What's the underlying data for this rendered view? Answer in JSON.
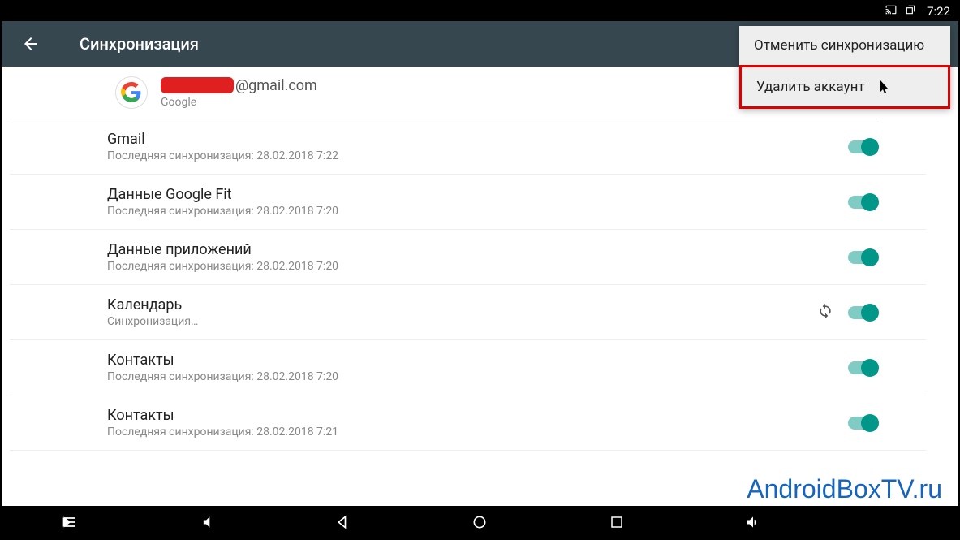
{
  "status": {
    "time": "7:22"
  },
  "appbar": {
    "title": "Синхронизация"
  },
  "menu": {
    "cancel_sync": "Отменить синхронизацию",
    "delete_account": "Удалить аккаунт"
  },
  "account": {
    "email_suffix": "@gmail.com",
    "provider": "Google"
  },
  "sync_items": [
    {
      "title": "Gmail",
      "sub": "Последняя синхронизация: 28.02.2018 7:22",
      "syncing": false
    },
    {
      "title": "Данные Google Fit",
      "sub": "Последняя синхронизация: 28.02.2018 7:20",
      "syncing": false
    },
    {
      "title": "Данные приложений",
      "sub": "Последняя синхронизация: 28.02.2018 7:20",
      "syncing": false
    },
    {
      "title": "Календарь",
      "sub": "Синхронизация…",
      "syncing": true
    },
    {
      "title": "Контакты",
      "sub": "Последняя синхронизация: 28.02.2018 7:20",
      "syncing": false
    },
    {
      "title": "Контакты",
      "sub": "Последняя синхронизация: 28.02.2018 7:21",
      "syncing": false
    }
  ],
  "watermark": "AndroidBoxTV.ru"
}
